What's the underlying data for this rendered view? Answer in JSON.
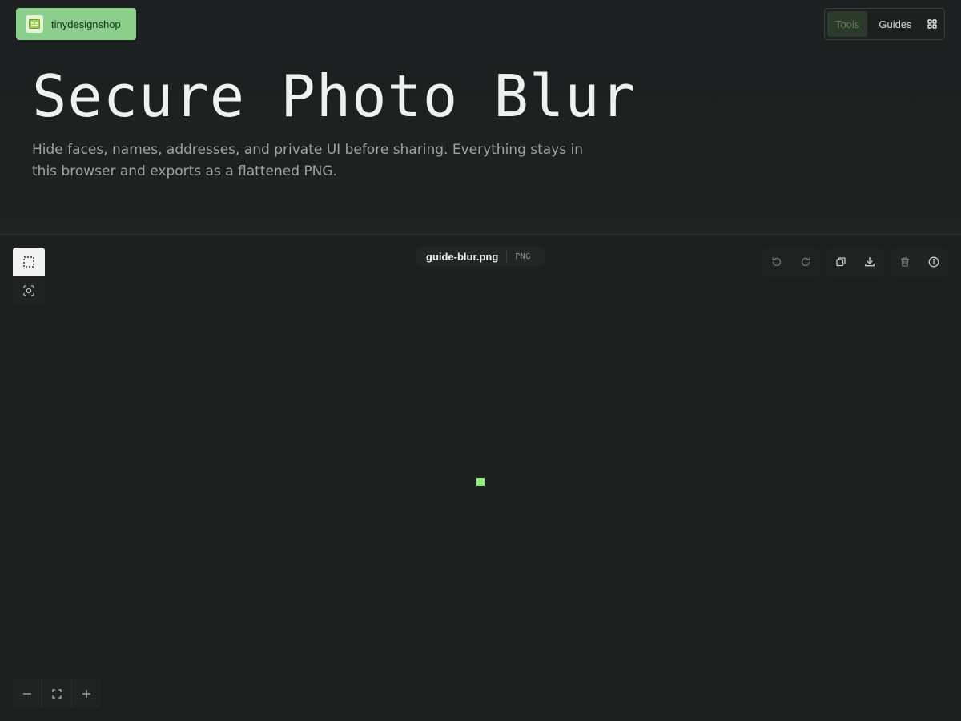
{
  "header": {
    "brand_label": "tinydesignshop",
    "nav": {
      "tools_label": "Tools",
      "guides_label": "Guides",
      "apps_icon": "grid-icon"
    },
    "title": "Secure Photo Blur",
    "subtitle": "Hide faces, names, addresses, and private UI before sharing. Everything stays in this browser and exports as a flattened PNG."
  },
  "workspace": {
    "tools": [
      {
        "name": "select-region-tool",
        "icon": "dashed-rect-icon",
        "active": true
      },
      {
        "name": "face-detect-tool",
        "icon": "face-scan-icon",
        "active": false
      }
    ],
    "file": {
      "name": "guide-blur.png",
      "type": "PNG"
    },
    "actions": {
      "history": [
        "undo-icon",
        "redo-icon"
      ],
      "file": [
        "copy-icon",
        "download-icon"
      ],
      "misc": [
        "trash-icon",
        "info-icon"
      ]
    },
    "zoom": [
      "zoom-out-icon",
      "fit-screen-icon",
      "zoom-in-icon"
    ]
  },
  "colors": {
    "background": "#1b1f1e",
    "accent_green": "#8ccf8c",
    "canvas_marker": "#8ef07d"
  }
}
